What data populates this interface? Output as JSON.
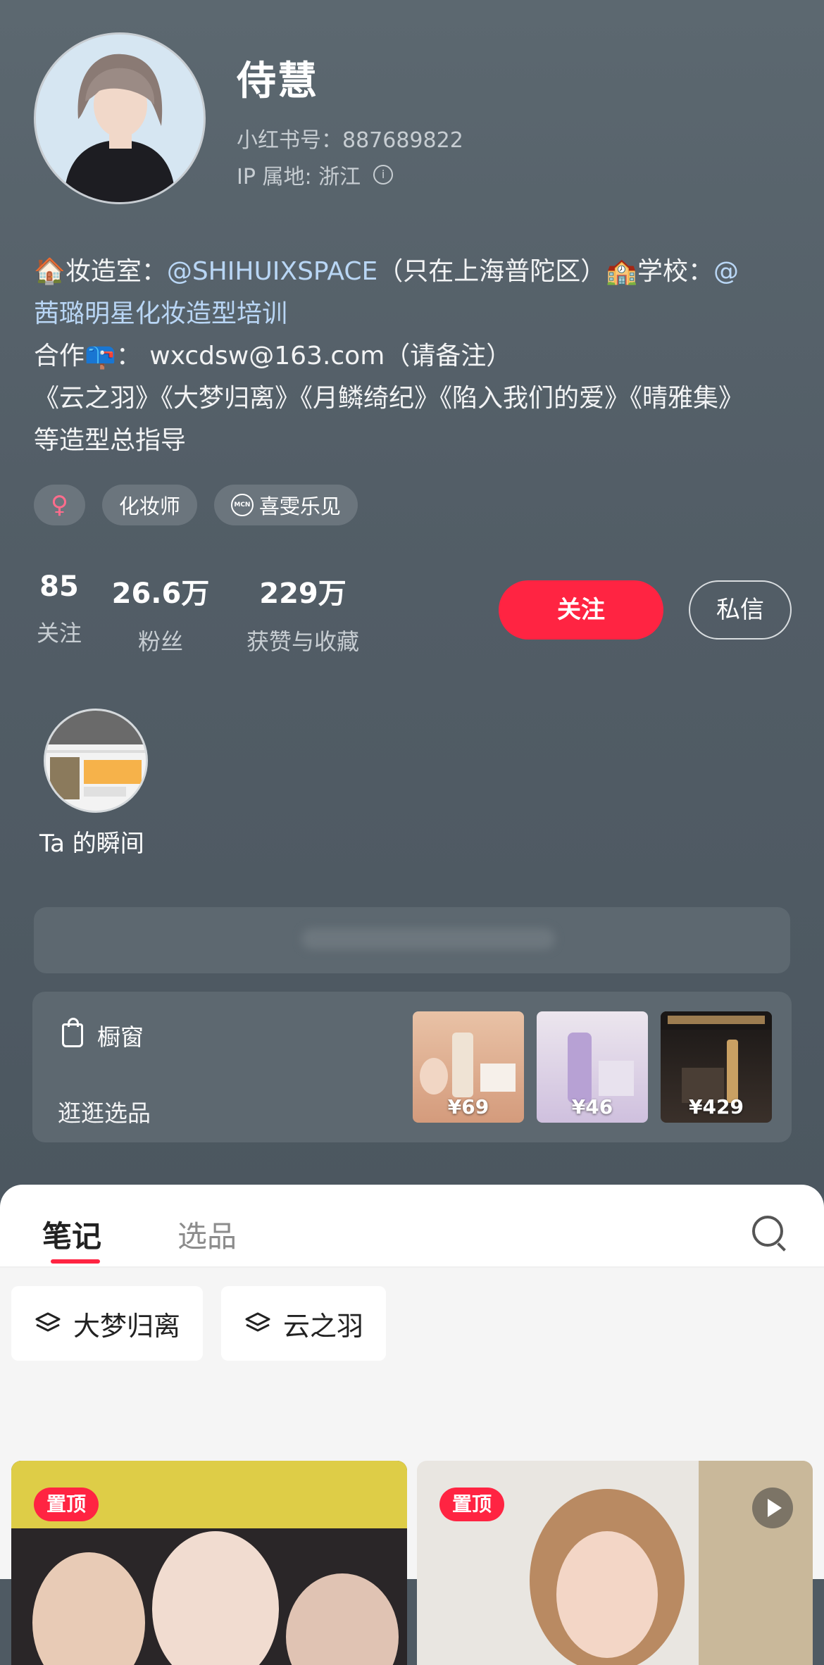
{
  "profile": {
    "name": "侍慧",
    "id_line": "小红书号：887689822",
    "ip_line": "IP 属地: 浙江"
  },
  "bio": {
    "l1a": "🏠妆造室：",
    "l1b": "@SHIHUIXSPACE",
    "l1c": "（只在上海普陀区）🏫学校：",
    "l1d": "@",
    "l2": "茜璐明星化妆造型培训",
    "l3": "合作📪：  wxcdsw@163.com（请备注）",
    "l4": "《云之羽》《大梦归离》《月鳞绮纪》《陷入我们的爱》《晴雅集》",
    "l5": "等造型总指导"
  },
  "tags": {
    "gender": "♀",
    "job": "化妆师",
    "mcn_icon": "MCN",
    "mcn": "喜雯乐见"
  },
  "stats": {
    "following_num": "85",
    "following_lbl": "关注",
    "fans_num": "26.6万",
    "fans_lbl": "粉丝",
    "likes_num": "229万",
    "likes_lbl": "获赞与收藏"
  },
  "actions": {
    "follow": "关注",
    "message": "私信"
  },
  "moments": {
    "label": "Ta 的瞬间"
  },
  "shop": {
    "title": "橱窗",
    "subtitle": "逛逛选品",
    "products": [
      {
        "price": "¥69"
      },
      {
        "price": "¥46"
      },
      {
        "price": "¥429"
      }
    ]
  },
  "tabs": {
    "notes": "笔记",
    "selections": "选品"
  },
  "collections": {
    "c1": "大梦归离",
    "c2": "云之羽"
  },
  "notes": {
    "pin1": "置顶",
    "pin2": "置顶"
  },
  "icons": [
    "info-icon",
    "bag-icon",
    "search-icon",
    "layers-icon",
    "play-icon",
    "mcn-icon"
  ],
  "colors": {
    "accent": "#ff2442",
    "background": "#4f5a63"
  }
}
